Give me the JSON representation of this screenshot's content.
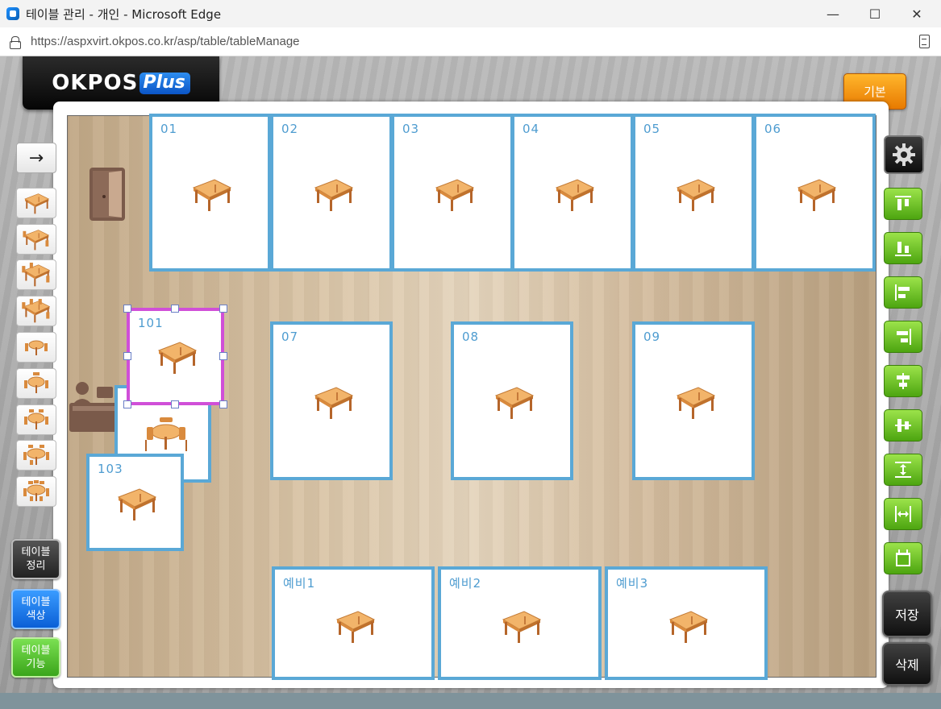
{
  "window": {
    "title": "테이블 관리 - 개인 - Microsoft Edge",
    "minimize": "—",
    "maximize": "☐",
    "close": "✕"
  },
  "address": {
    "url": "https://aspxvirt.okpos.co.kr/asp/table/tableManage"
  },
  "header": {
    "logo_main": "OKPOS",
    "logo_plus": "Plus",
    "basic_button": "기본"
  },
  "left_toolbar": {
    "arrow": "→",
    "tools": [
      "table-2",
      "table-4",
      "table-6",
      "table-8",
      "round-table-2",
      "round-table-4",
      "round-table-6",
      "round-table-8",
      "round-table-10"
    ],
    "arrange_button": "테이블\n정리",
    "color_button": "테이블\n색상",
    "function_button": "테이블\n기능"
  },
  "tables": {
    "t01": "01",
    "t02": "02",
    "t03": "03",
    "t04": "04",
    "t05": "05",
    "t06": "06",
    "t07": "07",
    "t08": "08",
    "t09": "09",
    "t101": "101",
    "t103": "103",
    "r1": "예비1",
    "r2": "예비2",
    "r3": "예비3"
  },
  "right_toolbar": {
    "settings": "gear-icon",
    "align": [
      "align-top-icon",
      "align-bottom-icon",
      "align-left-icon",
      "align-right-icon",
      "align-center-horizontal-icon",
      "align-center-vertical-icon",
      "distribute-vertical-icon",
      "distribute-horizontal-icon",
      "same-size-icon"
    ],
    "save_button": "저장",
    "delete_button": "삭제"
  },
  "colors": {
    "table_border": "#5aa8d6",
    "selected_border": "#d04fd8",
    "basic_button": "#f39200",
    "align_button": "#6cc21f",
    "color_button": "#1b7fe0",
    "function_button": "#5cc23a"
  }
}
